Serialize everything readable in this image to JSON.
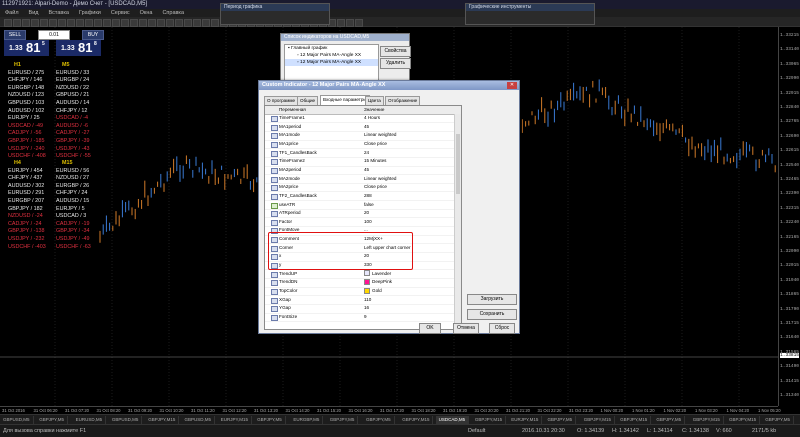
{
  "window": {
    "title": "112971921: Alpari-Demo - Демо Счет - [USDCAD,M5]"
  },
  "menu": [
    "Файл",
    "Вид",
    "Вставка",
    "Графики",
    "Сервис",
    "Окна",
    "Справка"
  ],
  "floating": {
    "period_title": "Период графика",
    "graph_tools_title": "Графические инструменты"
  },
  "trade": {
    "sell_label": "SELL",
    "buy_label": "BUY",
    "lot_value": "0.01",
    "bid": {
      "small": "1.33",
      "big": "81",
      "sup": "5"
    },
    "ask": {
      "small": "1.33",
      "big": "81",
      "sup": "8"
    }
  },
  "panels": [
    {
      "header": "H1",
      "items": [
        {
          "t": "EURUSD / 275",
          "neg": false
        },
        {
          "t": "CHFJPY / 146",
          "neg": false
        },
        {
          "t": "EURGBP / 148",
          "neg": false
        },
        {
          "t": "NZDUSD / 123",
          "neg": false
        },
        {
          "t": "GBPUSD / 103",
          "neg": false
        },
        {
          "t": "AUDUSD / 102",
          "neg": false
        },
        {
          "t": "EURJPY / 25",
          "neg": false
        },
        {
          "t": "USDCAD / -49",
          "neg": true
        },
        {
          "t": "CADJPY / -56",
          "neg": true
        },
        {
          "t": "GBPJPY / -185",
          "neg": true
        },
        {
          "t": "USDJPY / -240",
          "neg": true
        },
        {
          "t": "USDCHF / -408",
          "neg": true
        }
      ]
    },
    {
      "header": "M5",
      "items": [
        {
          "t": "EURUSD / 33",
          "neg": false
        },
        {
          "t": "EURGBP / 24",
          "neg": false
        },
        {
          "t": "NZDUSD / 22",
          "neg": false
        },
        {
          "t": "GBPUSD / 21",
          "neg": false
        },
        {
          "t": "AUDUSD / 14",
          "neg": false
        },
        {
          "t": "CHFJPY / 12",
          "neg": false
        },
        {
          "t": "USDCAD / -4",
          "neg": true
        },
        {
          "t": "AUDUSD / -6",
          "neg": true
        },
        {
          "t": "CADJPY / -27",
          "neg": true
        },
        {
          "t": "GBPJPY / -39",
          "neg": true
        },
        {
          "t": "USDJPY / -43",
          "neg": true
        },
        {
          "t": "USDCHF / -55",
          "neg": true
        }
      ]
    },
    {
      "header": "H4",
      "items": [
        {
          "t": "EURJPY / 454",
          "neg": false
        },
        {
          "t": "CHFJPY / 437",
          "neg": false
        },
        {
          "t": "AUDUSD / 302",
          "neg": false
        },
        {
          "t": "EURUSD / 291",
          "neg": false
        },
        {
          "t": "EURGBP / 207",
          "neg": false
        },
        {
          "t": "GBPJPY / 182",
          "neg": false
        },
        {
          "t": "NZDUSD / -24",
          "neg": true
        },
        {
          "t": "CADJPY / -24",
          "neg": true
        },
        {
          "t": "GBPJPY / -138",
          "neg": true
        },
        {
          "t": "USDJPY / -232",
          "neg": true
        },
        {
          "t": "USDCHF / -403",
          "neg": true
        }
      ]
    },
    {
      "header": "M15",
      "items": [
        {
          "t": "EURUSD / 56",
          "neg": false
        },
        {
          "t": "NZDUSD / 27",
          "neg": false
        },
        {
          "t": "EURGBP / 26",
          "neg": false
        },
        {
          "t": "CHFJPY / 24",
          "neg": false
        },
        {
          "t": "AUDUSD / 15",
          "neg": false
        },
        {
          "t": "EURJPY / 5",
          "neg": false
        },
        {
          "t": "USDCAD / 3",
          "neg": false
        },
        {
          "t": "CADJPY / -19",
          "neg": true
        },
        {
          "t": "GBPJPY / -34",
          "neg": true
        },
        {
          "t": "USDJPY / -49",
          "neg": true
        },
        {
          "t": "USDCHF / -63",
          "neg": true
        }
      ]
    }
  ],
  "list_window": {
    "title": "Список индикаторов на USDCAD,M5",
    "root": "Главный график",
    "items": [
      "12 Major Pairs MA-Angle XX",
      "12 Major Pairs MA-Angle XX"
    ],
    "props_label": "Свойства",
    "delete_label": "Удалить"
  },
  "dialog": {
    "title": "Custom Indicator - 12 Major Pairs MA-Angle XX",
    "tabs": [
      "О программе",
      "Общие",
      "Входные параметры",
      "Цвета",
      "Отображение"
    ],
    "col_var": "Переменная",
    "col_val": "Значение",
    "rows": [
      {
        "n": "TimeFrame1",
        "v": "4 Hours",
        "b": false
      },
      {
        "n": "MA1period",
        "v": "45",
        "b": false
      },
      {
        "n": "MA1mode",
        "v": "Linear weighted",
        "b": false
      },
      {
        "n": "MA1price",
        "v": "Close price",
        "b": false
      },
      {
        "n": "TF1_CandlesBack",
        "v": "24",
        "b": false
      },
      {
        "n": "TimeFrame2",
        "v": "15 Minutes",
        "b": false
      },
      {
        "n": "MA2period",
        "v": "45",
        "b": false
      },
      {
        "n": "MA2mode",
        "v": "Linear weighted",
        "b": false
      },
      {
        "n": "MA2price",
        "v": "Close price",
        "b": false
      },
      {
        "n": "TF2_CandlesBack",
        "v": "288",
        "b": false
      },
      {
        "n": "useATR",
        "v": "false",
        "b": true
      },
      {
        "n": "ATRperiod",
        "v": "20",
        "b": false
      },
      {
        "n": "Factor",
        "v": "100",
        "b": false
      },
      {
        "n": "FontMove",
        "v": "...",
        "b": false
      },
      {
        "n": "Comment",
        "v": "12MjXX+",
        "b": false
      },
      {
        "n": "Corner",
        "v": "Left upper chart corner",
        "b": false
      },
      {
        "n": "x",
        "v": "20",
        "b": false
      },
      {
        "n": "y",
        "v": "330",
        "b": false
      },
      {
        "n": "TrendUP",
        "v": "Lavender",
        "b": false,
        "c": "#e6e6fa"
      },
      {
        "n": "TrendDN",
        "v": "DeepPink",
        "b": false,
        "c": "#ff1493"
      },
      {
        "n": "TopColor",
        "v": "Gold",
        "b": false,
        "c": "#ffd700"
      },
      {
        "n": "XGap",
        "v": "110",
        "b": false
      },
      {
        "n": "YGap",
        "v": "16",
        "b": false
      },
      {
        "n": "FontSize",
        "v": "9",
        "b": false
      }
    ],
    "load_label": "Загрузить",
    "save_label": "Сохранить",
    "ok_label": "OK",
    "cancel_label": "Отмена",
    "reset_label": "Сброс"
  },
  "price_axis": [
    "1.33215",
    "1.33140",
    "1.33065",
    "1.32990",
    "1.32915",
    "1.32840",
    "1.32765",
    "1.32690",
    "1.32615",
    "1.32540",
    "1.32465",
    "1.32390",
    "1.32315",
    "1.32240",
    "1.32165",
    "1.32090",
    "1.32015",
    "1.31940",
    "1.31865",
    "1.31790",
    "1.31715",
    "1.31640",
    "1.31565",
    "1.31490",
    "1.31415",
    "1.31340"
  ],
  "price_current": "1.33815",
  "time_axis": [
    "31 Oct 2016",
    "31 Oct 06:20",
    "31 Oct 07:20",
    "31 Oct 08:20",
    "31 Oct 09:20",
    "31 Oct 10:20",
    "31 Oct 11:20",
    "31 Oct 12:20",
    "31 Oct 13:20",
    "31 Oct 14:20",
    "31 Oct 15:20",
    "31 Oct 16:20",
    "31 Oct 17:20",
    "31 Oct 18:20",
    "31 Oct 19:20",
    "31 Oct 20:20",
    "31 Oct 21:20",
    "31 Oct 22:20",
    "31 Oct 23:20",
    "1 Nov 00:20",
    "1 Nov 01:20",
    "1 Nov 02:20",
    "1 Nov 03:20",
    "1 Nov 04:20",
    "1 Nov 05:20"
  ],
  "chart_tabs": [
    "GBPUSD,M5",
    "GBPJPY,M5",
    "EURUSD,M5",
    "GBPUSD,M5",
    "GBPJPY,M15",
    "GBPUSD,M5",
    "EURJPY,M15",
    "GBPJPY,M5",
    "EURGBP,M5",
    "GBPJPY,M5",
    "GBPJPY,M5",
    "GBPJPY,M15",
    "USDCAD,M5",
    "GBPJPY,M15",
    "EURJPY,M15",
    "GBPJPY,M5",
    "GBPJPY,M15",
    "GBPJPY,M15",
    "GBPJPY,M5",
    "GBPJPY,M15",
    "GBPJPY,M15",
    "GBPJPY,M5"
  ],
  "active_tab": 12,
  "status": {
    "help": "Для вызова справки нажмите F1",
    "profile": "Default",
    "datetime": "2016.10.31 20:30",
    "open": "O: 1.34139",
    "high": "H: 1.34142",
    "low": "L: 1.34114",
    "close": "C: 1.34138",
    "volume": "V: 660",
    "traffic": "2171/5 kb"
  }
}
